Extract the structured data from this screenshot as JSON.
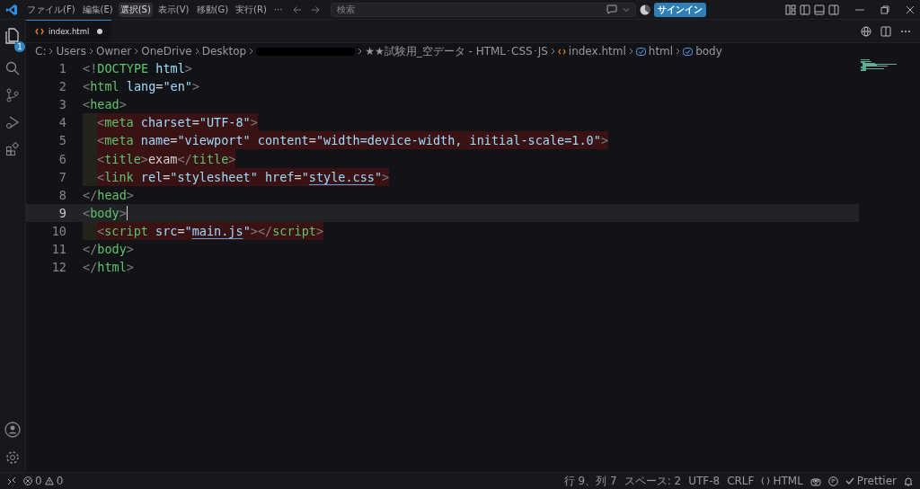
{
  "menu": [
    {
      "label": "ファイル(F)",
      "selected": false
    },
    {
      "label": "編集(E)",
      "selected": false
    },
    {
      "label": "選択(S)",
      "selected": true
    },
    {
      "label": "表示(V)",
      "selected": false
    },
    {
      "label": "移動(G)",
      "selected": false
    },
    {
      "label": "実行(R)",
      "selected": false
    },
    {
      "label": "···",
      "selected": false
    }
  ],
  "search": {
    "placeholder": "検索"
  },
  "signin": "サインイン",
  "activity_bar": {
    "badge": "1"
  },
  "tabs": [
    {
      "label": "index.html",
      "selected": true,
      "modified": true
    }
  ],
  "breadcrumb": [
    {
      "label": "C:",
      "kind": "text"
    },
    {
      "label": "Users",
      "kind": "text"
    },
    {
      "label": "Owner",
      "kind": "text"
    },
    {
      "label": "OneDrive",
      "kind": "text"
    },
    {
      "label": "Desktop",
      "kind": "text"
    },
    {
      "kind": "redacted"
    },
    {
      "label": "★★試験用_空データ - HTML･CSS･JS",
      "kind": "text"
    },
    {
      "label": "index.html",
      "kind": "file"
    },
    {
      "label": "html",
      "kind": "element"
    },
    {
      "label": "body",
      "kind": "element"
    }
  ],
  "code": {
    "lines": [
      {
        "number": "1",
        "indented": false,
        "highlighted": false,
        "current": false,
        "tokens": [
          {
            "kind": "punct",
            "text": "<!"
          },
          {
            "kind": "tag",
            "text": "DOCTYPE"
          },
          {
            "kind": "attr",
            "text": " html"
          },
          {
            "kind": "punct",
            "text": ">"
          }
        ]
      },
      {
        "number": "2",
        "indented": false,
        "highlighted": false,
        "current": false,
        "tokens": [
          {
            "kind": "punct",
            "text": "<"
          },
          {
            "kind": "tag",
            "text": "html"
          },
          {
            "kind": "attr",
            "text": " lang"
          },
          {
            "kind": "plain",
            "text": "="
          },
          {
            "kind": "str",
            "text": "\"en\""
          },
          {
            "kind": "punct",
            "text": ">"
          }
        ]
      },
      {
        "number": "3",
        "indented": false,
        "highlighted": false,
        "current": false,
        "tokens": [
          {
            "kind": "punct",
            "text": "<"
          },
          {
            "kind": "tag",
            "text": "head"
          },
          {
            "kind": "punct",
            "text": ">"
          }
        ]
      },
      {
        "number": "4",
        "indented": true,
        "highlighted": true,
        "current": false,
        "tokens": [
          {
            "kind": "punct",
            "text": "<"
          },
          {
            "kind": "tag",
            "text": "meta"
          },
          {
            "kind": "attr",
            "text": " charset"
          },
          {
            "kind": "plain",
            "text": "="
          },
          {
            "kind": "str",
            "text": "\"UTF-8\""
          },
          {
            "kind": "punct",
            "text": ">"
          }
        ]
      },
      {
        "number": "5",
        "indented": true,
        "highlighted": true,
        "current": false,
        "tokens": [
          {
            "kind": "punct",
            "text": "<"
          },
          {
            "kind": "tag",
            "text": "meta"
          },
          {
            "kind": "attr",
            "text": " name"
          },
          {
            "kind": "plain",
            "text": "="
          },
          {
            "kind": "str",
            "text": "\"viewport\""
          },
          {
            "kind": "attr",
            "text": " content"
          },
          {
            "kind": "plain",
            "text": "="
          },
          {
            "kind": "str",
            "text": "\"width=device-width, initial-scale=1.0\""
          },
          {
            "kind": "punct",
            "text": ">"
          }
        ]
      },
      {
        "number": "6",
        "indented": true,
        "highlighted": true,
        "current": false,
        "tokens": [
          {
            "kind": "punct",
            "text": "<"
          },
          {
            "kind": "tag",
            "text": "title"
          },
          {
            "kind": "punct",
            "text": ">"
          },
          {
            "kind": "plain",
            "text": "exam"
          },
          {
            "kind": "punct",
            "text": "</"
          },
          {
            "kind": "tag",
            "text": "title"
          },
          {
            "kind": "punct",
            "text": ">"
          }
        ]
      },
      {
        "number": "7",
        "indented": true,
        "highlighted": true,
        "current": false,
        "tokens": [
          {
            "kind": "punct",
            "text": "<"
          },
          {
            "kind": "tag",
            "text": "link"
          },
          {
            "kind": "attr",
            "text": " rel"
          },
          {
            "kind": "plain",
            "text": "="
          },
          {
            "kind": "str",
            "text": "\"stylesheet\""
          },
          {
            "kind": "attr",
            "text": " href"
          },
          {
            "kind": "plain",
            "text": "="
          },
          {
            "kind": "str",
            "text": "\""
          },
          {
            "kind": "link",
            "text": "style.css"
          },
          {
            "kind": "str",
            "text": "\""
          },
          {
            "kind": "punct",
            "text": ">"
          }
        ]
      },
      {
        "number": "8",
        "indented": false,
        "highlighted": false,
        "current": false,
        "tokens": [
          {
            "kind": "punct",
            "text": "</"
          },
          {
            "kind": "tag",
            "text": "head"
          },
          {
            "kind": "punct",
            "text": ">"
          }
        ]
      },
      {
        "number": "9",
        "indented": false,
        "highlighted": false,
        "current": true,
        "tokens": [
          {
            "kind": "punct",
            "text": "<"
          },
          {
            "kind": "tag",
            "text": "body"
          },
          {
            "kind": "punct",
            "text": ">"
          }
        ]
      },
      {
        "number": "10",
        "indented": true,
        "highlighted": true,
        "current": false,
        "tokens": [
          {
            "kind": "punct",
            "text": "<"
          },
          {
            "kind": "tag",
            "text": "script"
          },
          {
            "kind": "attr",
            "text": " src"
          },
          {
            "kind": "plain",
            "text": "="
          },
          {
            "kind": "str",
            "text": "\""
          },
          {
            "kind": "link",
            "text": "main.js"
          },
          {
            "kind": "str",
            "text": "\""
          },
          {
            "kind": "punct",
            "text": "></"
          },
          {
            "kind": "tag",
            "text": "script"
          },
          {
            "kind": "punct",
            "text": ">"
          }
        ]
      },
      {
        "number": "11",
        "indented": false,
        "highlighted": false,
        "current": false,
        "tokens": [
          {
            "kind": "punct",
            "text": "</"
          },
          {
            "kind": "tag",
            "text": "body"
          },
          {
            "kind": "punct",
            "text": ">"
          }
        ]
      },
      {
        "number": "12",
        "indented": false,
        "highlighted": false,
        "current": false,
        "tokens": [
          {
            "kind": "punct",
            "text": "</"
          },
          {
            "kind": "tag",
            "text": "html"
          },
          {
            "kind": "punct",
            "text": ">"
          }
        ]
      }
    ]
  },
  "status_bar": {
    "errors": "0",
    "warnings": "0",
    "right": [
      {
        "kind": "text",
        "label": "行 9、列 7"
      },
      {
        "kind": "text",
        "label": "スペース: 2"
      },
      {
        "kind": "text",
        "label": "UTF-8"
      },
      {
        "kind": "text",
        "label": "CRLF"
      },
      {
        "kind": "language",
        "label": "HTML"
      },
      {
        "kind": "copilot"
      },
      {
        "kind": "feedback"
      },
      {
        "kind": "prettier",
        "label": "Prettier"
      },
      {
        "kind": "bell"
      }
    ]
  }
}
